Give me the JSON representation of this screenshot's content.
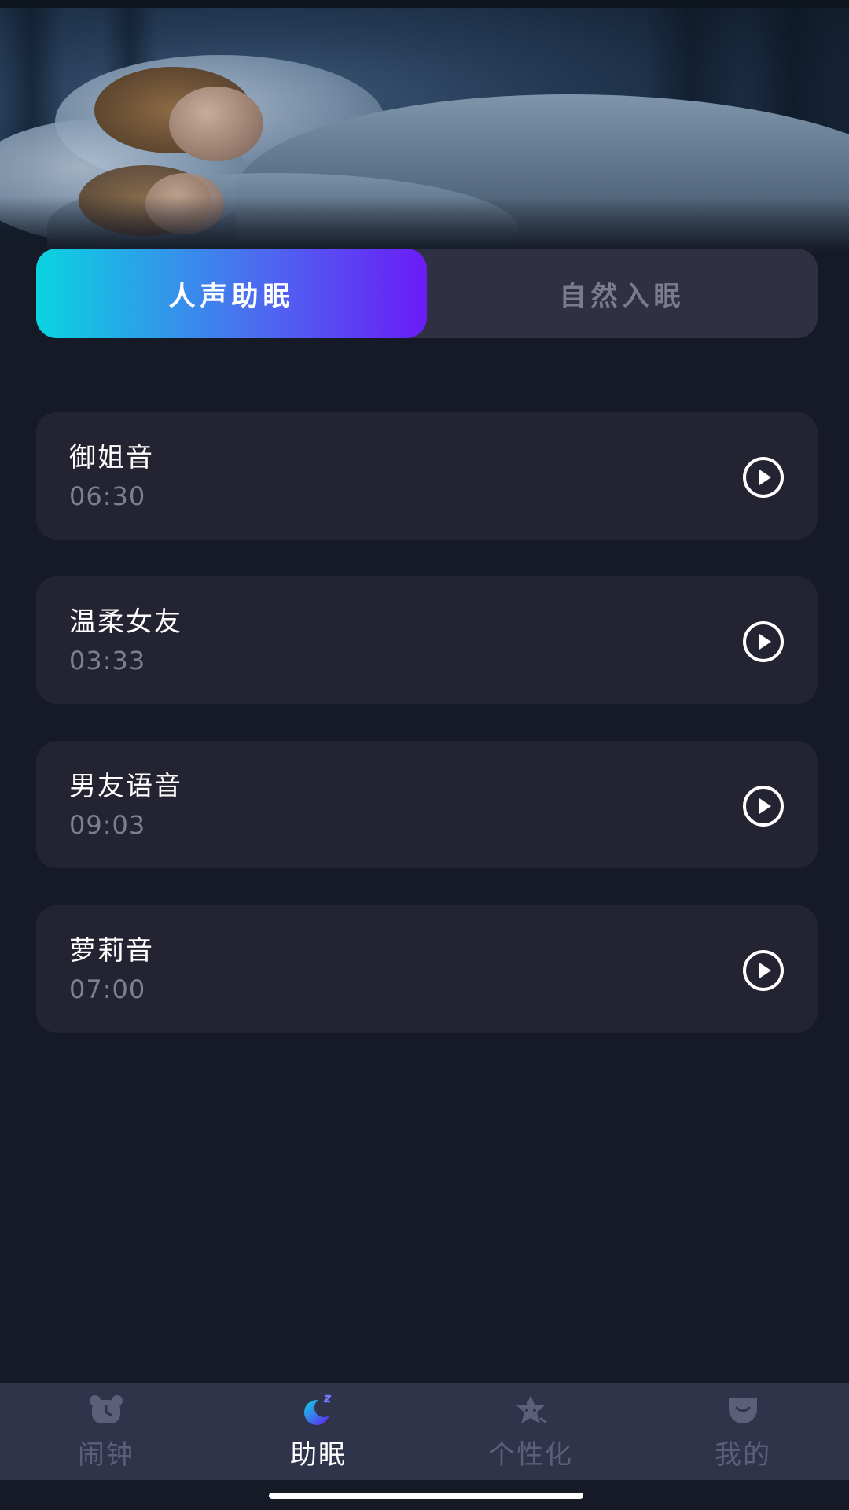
{
  "tabs": [
    {
      "label": "人声助眠",
      "active": true
    },
    {
      "label": "自然入眠",
      "active": false
    }
  ],
  "tracks": [
    {
      "title": "御姐音",
      "duration": "06:30",
      "icon": "play-icon"
    },
    {
      "title": "温柔女友",
      "duration": "03:33",
      "icon": "play-icon"
    },
    {
      "title": "男友语音",
      "duration": "09:03",
      "icon": "play-icon"
    },
    {
      "title": "萝莉音",
      "duration": "07:00",
      "icon": "play-icon"
    }
  ],
  "bottom_nav": [
    {
      "label": "闹钟",
      "icon": "bear-clock-icon",
      "active": false
    },
    {
      "label": "助眠",
      "icon": "moon-sleep-icon",
      "active": true
    },
    {
      "label": "个性化",
      "icon": "star-face-icon",
      "active": false
    },
    {
      "label": "我的",
      "icon": "smile-face-icon",
      "active": false
    }
  ],
  "colors": {
    "background": "#151a26",
    "card": "#232332",
    "tab_track": "#2f3044",
    "accent_start": "#0ad4e0",
    "accent_end": "#6a1cf6",
    "nav_background": "#30344a"
  }
}
